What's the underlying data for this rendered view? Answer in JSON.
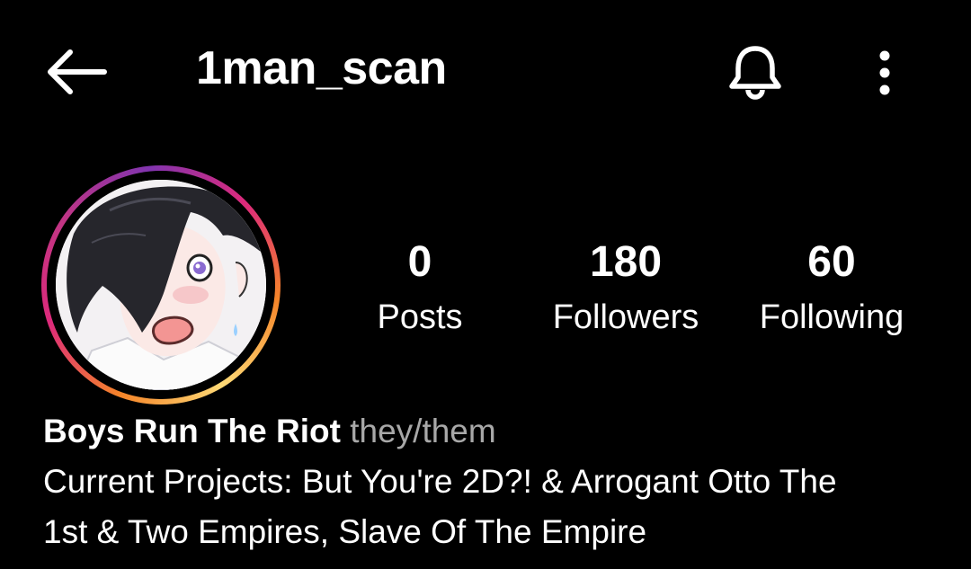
{
  "header": {
    "username": "1man_scan",
    "icons": {
      "back": "arrow-left-icon",
      "notifications": "bell-icon",
      "more": "more-vertical-icon"
    }
  },
  "profile": {
    "avatar": "anime-boy-avatar",
    "stats": [
      {
        "value": "0",
        "label": "Posts"
      },
      {
        "value": "180",
        "label": "Followers"
      },
      {
        "value": "60",
        "label": "Following"
      }
    ],
    "display_name": "Boys Run The Riot",
    "pronouns": "they/them",
    "bio_line1": "Current Projects: But You're 2D?! & Arrogant Otto The",
    "bio_line2": "1st & Two Empires, Slave Of The Empire"
  },
  "colors": {
    "background": "#000000",
    "text": "#ffffff",
    "muted": "#a8a8a8",
    "ring_gradient": [
      "#f58529",
      "#dd2a7b",
      "#8134af"
    ]
  }
}
